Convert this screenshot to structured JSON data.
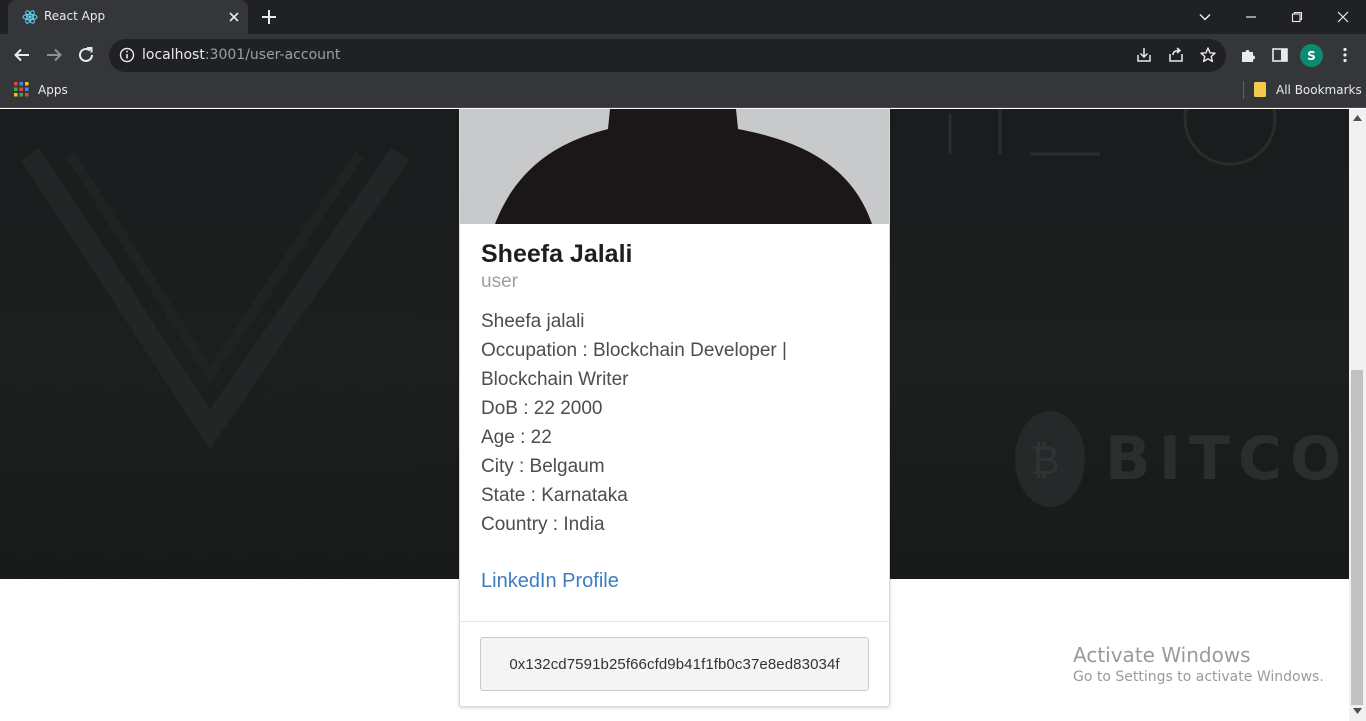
{
  "browser": {
    "tab_title": "React App",
    "url_host": "localhost",
    "url_path": ":3001/user-account",
    "profile_initial": "S",
    "bookmarks": {
      "apps_label": "Apps",
      "all_bookmarks_label": "All Bookmarks"
    }
  },
  "hero": {
    "background_color": "#1b1d1e",
    "watermark_text": "BITCOIN"
  },
  "profile": {
    "name": "Sheefa Jalali",
    "role": "user",
    "details": [
      "Sheefa jalali",
      "Occupation : Blockchain Developer |\nBlockchain Writer",
      "DoB : 22 2000",
      "Age : 22",
      "City : Belgaum",
      "State : Karnataka",
      "Country : India"
    ],
    "linkedin_label": "LinkedIn Profile",
    "wallet_address": "0x132cd7591b25f66cfd9b41f1fb0c37e8ed83034f",
    "link_color": "#3d7dbe"
  },
  "os_watermark": {
    "title": "Activate Windows",
    "subtitle": "Go to Settings to activate Windows."
  }
}
